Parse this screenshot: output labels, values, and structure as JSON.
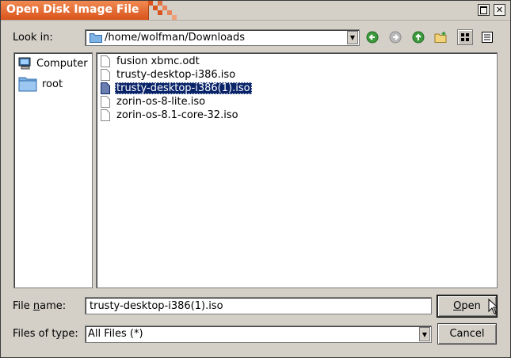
{
  "window": {
    "title": "Open Disk Image File",
    "maximize_icon": "maximize-icon",
    "close_icon": "close-icon"
  },
  "look_in": {
    "label_pre": "Look in:",
    "path": "/home/wolfman/Downloads",
    "toolbar": [
      {
        "name": "back-button",
        "icon": "back-arrow-icon"
      },
      {
        "name": "forward-button",
        "icon": "forward-arrow-icon"
      },
      {
        "name": "parent-directory-button",
        "icon": "up-arrow-icon"
      },
      {
        "name": "new-folder-button",
        "icon": "new-folder-icon"
      },
      {
        "name": "list-view-button",
        "icon": "list-view-icon"
      },
      {
        "name": "detail-view-button",
        "icon": "detail-view-icon"
      }
    ]
  },
  "sidebar": {
    "items": [
      {
        "label": "Computer",
        "icon": "computer-icon"
      },
      {
        "label": "root",
        "icon": "folder-icon"
      }
    ]
  },
  "files": [
    {
      "name": "fusion xbmc.odt",
      "selected": false
    },
    {
      "name": "trusty-desktop-i386.iso",
      "selected": false
    },
    {
      "name": "trusty-desktop-i386(1).iso",
      "selected": true
    },
    {
      "name": "zorin-os-8-lite.iso",
      "selected": false
    },
    {
      "name": "zorin-os-8.1-core-32.iso",
      "selected": false
    }
  ],
  "file_name": {
    "label_pre": "File ",
    "label_underlined": "n",
    "label_post": "ame:",
    "value": "trusty-desktop-i386(1).iso"
  },
  "file_type": {
    "label": "Files of type:",
    "value": "All Files (*)"
  },
  "buttons": {
    "open_underlined": "O",
    "open_rest": "pen",
    "cancel": "Cancel"
  },
  "colors": {
    "title_accent": "#d9541c",
    "selection": "#0a246a",
    "dialog_bg": "#d4d0c8",
    "nav_green": "#3c9a3c"
  }
}
